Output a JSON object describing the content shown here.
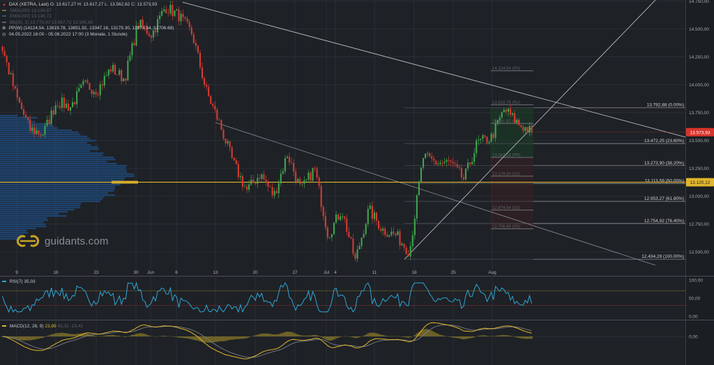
{
  "legend": {
    "title": "DAX (XETRA, Last)",
    "o": "O: 13.617,27",
    "h": "H: 13.617,27",
    "l": "L: 13.562,62",
    "c": "C: 13.573,93",
    "sma": "SMA(200)",
    "sma_val": "13.130,87",
    "ema": "EMA(200)",
    "ema_val": "13.136,72",
    "bb": "BB(20, 2)",
    "bb_vals": "13.770,00  13.657,72  13.545,80",
    "pp": "PP(W)",
    "pp_vals": "(14124.54, 13819.78, 13651.92, 13347.16, 13179.30, 12874.54, 12706.68)",
    "range": "04.05.2022 16:00 - 05.08.2022 17:00",
    "range_note": "(3 Monate, 1 Stunde)"
  },
  "logo_text": "guidants.com",
  "rsi_label": "RSI(7)",
  "rsi_value": "35,03",
  "macd_label": "MACD(12, 26, 9)",
  "macd_value": "23,89",
  "macd_extra": "43,31  -19,42",
  "colors": {
    "bg": "#1e2126",
    "bull": "#3fa34d",
    "bear": "#d33b32",
    "grid": "#2b2f35",
    "fib": "#9a9da3",
    "volume_profile": "#1f4f86",
    "poc": "#e0b62b",
    "rsi": "#2fa6d6",
    "macd_line": "#e0b62b",
    "signal_line": "#7b7f86",
    "price_tag": "#d9342b",
    "poc_tag": "#e0b62b"
  },
  "chart_data": [
    {
      "type": "candlestick",
      "title": "DAX (XETRA, Last)",
      "interval": "1 Stunde",
      "yaxis": {
        "ticks": [
          14750,
          14500,
          14250,
          14000,
          13750,
          13500,
          13250,
          13000,
          12750,
          12500
        ],
        "tick_labels": [
          "14.750,00",
          "14.500,00",
          "14.250,00",
          "14.000,00",
          "13.750,00",
          "13.500,00",
          "13.250,00",
          "13.000,00",
          "12.750,00",
          "12.500,00"
        ],
        "range": [
          12360,
          14760
        ]
      },
      "xaxis": {
        "tick_labels": [
          "9",
          "16",
          "23",
          "30",
          "Jun",
          "6",
          "13",
          "20",
          "27",
          "Jul",
          "4",
          "11",
          "18",
          "25",
          "Aug"
        ]
      },
      "anchor_closes": [
        14320,
        13900,
        13600,
        13560,
        13850,
        13800,
        14000,
        13950,
        14150,
        14050,
        14550,
        14450,
        14700,
        14620,
        14450,
        13950,
        13650,
        13300,
        13050,
        13200,
        13000,
        13380,
        13050,
        13250,
        12650,
        12880,
        12420,
        12880,
        12700,
        12650,
        12500,
        13350,
        13300,
        13300,
        13150,
        13480,
        13520,
        13780,
        13650,
        13574
      ],
      "last": 13573.93,
      "last_label": "13.573,93",
      "poc": 13125.12,
      "poc_label": "13.125,12",
      "fibonacci": [
        {
          "level": 13792.88,
          "label": "13.792,88 (0.00%)"
        },
        {
          "level": 13472.25,
          "label": "13.472,25 (23.60%)"
        },
        {
          "level": 13273.9,
          "label": "13.273,90 (38.20%)"
        },
        {
          "level": 13113.59,
          "label": "13.113,59 (50.00%)"
        },
        {
          "level": 12953.27,
          "label": "12.953,27 (61.80%)"
        },
        {
          "level": 12754.92,
          "label": "12.754,92 (76.40%)"
        },
        {
          "level": 12434.29,
          "label": "12.434,29 (100.00%)"
        }
      ],
      "pivot_levels": [
        {
          "level": 14124.54,
          "label": "14.124,54 (R3)"
        },
        {
          "level": 13819.78,
          "label": "13.819,78 (R2)"
        },
        {
          "level": 13651.92,
          "label": "13.651,92 (R1)"
        },
        {
          "level": 13347.16,
          "label": "13.347,16 (PP)"
        },
        {
          "level": 13179.3,
          "label": "13.179,30 (S1)"
        },
        {
          "level": 12874.54,
          "label": "12.874,54 (S2)"
        },
        {
          "level": 12706.68,
          "label": "12.706,68 (S3)"
        }
      ]
    },
    {
      "type": "line",
      "name": "RSI(7)",
      "value": 35.03,
      "yaxis": {
        "ticks": [
          100,
          50,
          0
        ],
        "tick_labels": [
          "100,00",
          "50,00",
          "0,00"
        ],
        "range": [
          0,
          100
        ]
      },
      "upper": 70,
      "lower": 30
    },
    {
      "type": "line",
      "name": "MACD(12, 26, 9)",
      "value": 23.89,
      "yaxis": {
        "ticks": [
          0
        ],
        "tick_labels": [
          "0,00"
        ]
      }
    }
  ]
}
